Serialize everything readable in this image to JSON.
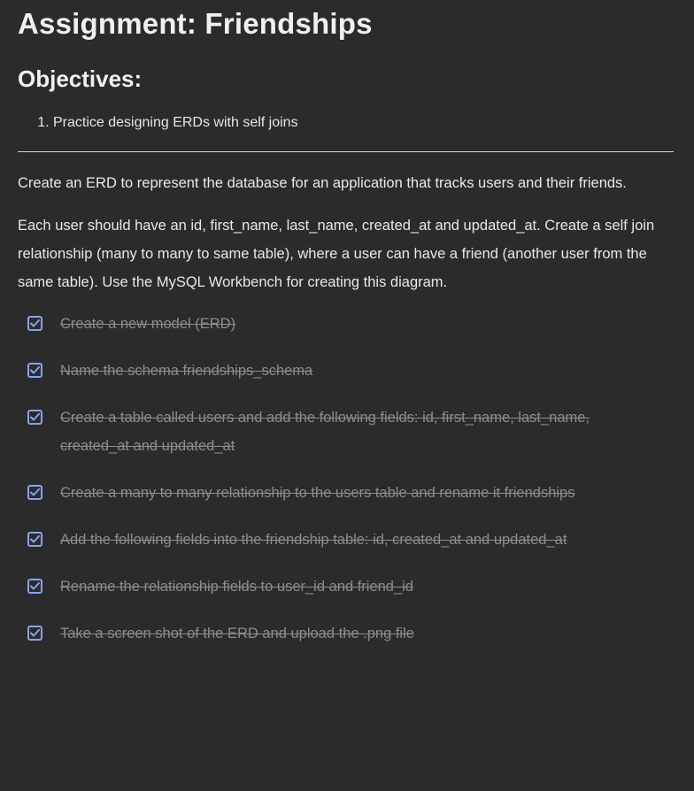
{
  "title": "Assignment: Friendships",
  "objectives_heading": "Objectives:",
  "objectives": [
    "Practice designing ERDs with self joins"
  ],
  "intro": "Create an ERD to represent the database for an application that tracks users and their friends.",
  "details": "Each user should have an id, first_name, last_name, created_at and updated_at. Create a self join relationship (many to many to same table), where a user can have a friend (another user from the same table). Use the MySQL Workbench for creating this diagram.",
  "tasks": [
    {
      "label": "Create a new model (ERD)",
      "checked": true
    },
    {
      "label": "Name the schema friendships_schema",
      "checked": true
    },
    {
      "label": "Create a table called users and add the following fields: id, first_name, last_name, created_at and updated_at",
      "checked": true
    },
    {
      "label": "Create a many to many relationship to the users table and rename it friendships",
      "checked": true
    },
    {
      "label": "Add the following fields into the friendship table: id, created_at and updated_at",
      "checked": true
    },
    {
      "label": "Rename the relationship fields to user_id and friend_id",
      "checked": true
    },
    {
      "label": "Take a screen shot of the ERD and upload the .png file",
      "checked": true
    }
  ],
  "colors": {
    "background": "#2b2b2b",
    "checkbox_accent": "#8aa2ea",
    "completed_text": "#8c8c8c"
  }
}
